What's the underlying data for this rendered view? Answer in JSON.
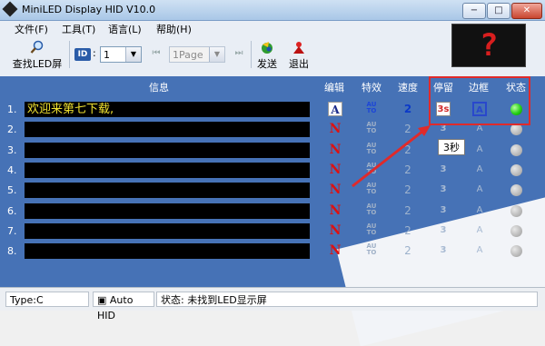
{
  "window": {
    "title": "MiniLED Display HID V10.0",
    "min_label": "−",
    "max_label": "□",
    "close_label": "✕"
  },
  "menu": [
    {
      "label": "文件(F)"
    },
    {
      "label": "工具(T)"
    },
    {
      "label": "语言(L)"
    },
    {
      "label": "帮助(H)"
    }
  ],
  "toolbar": {
    "search_label": "查找LED屏",
    "id_label": "ID",
    "id_value": "1",
    "page_value": "1Page",
    "send_label": "发送",
    "exit_label": "退出"
  },
  "led_preview": {
    "glyph": "?"
  },
  "table": {
    "headers": {
      "info": "信息",
      "edit": "编辑",
      "effect": "特效",
      "speed": "速度",
      "stay": "停留",
      "border": "边框",
      "status": "状态"
    },
    "rows": [
      {
        "num": "1.",
        "message": "欢迎来第七下载,",
        "edit": "A",
        "effect_top": "AU",
        "effect_bottom": "TO",
        "speed": "2",
        "stay": "3s",
        "border": "A",
        "active": true
      },
      {
        "num": "2.",
        "message": "",
        "edit": "N",
        "effect_top": "AU",
        "effect_bottom": "TO",
        "speed": "2",
        "stay": "3",
        "border": "A",
        "active": false
      },
      {
        "num": "3.",
        "message": "",
        "edit": "N",
        "effect_top": "AU",
        "effect_bottom": "TO",
        "speed": "2",
        "stay": "3",
        "border": "A",
        "active": false
      },
      {
        "num": "4.",
        "message": "",
        "edit": "N",
        "effect_top": "AU",
        "effect_bottom": "TO",
        "speed": "2",
        "stay": "3",
        "border": "A",
        "active": false
      },
      {
        "num": "5.",
        "message": "",
        "edit": "N",
        "effect_top": "AU",
        "effect_bottom": "TO",
        "speed": "2",
        "stay": "3",
        "border": "A",
        "active": false
      },
      {
        "num": "6.",
        "message": "",
        "edit": "N",
        "effect_top": "AU",
        "effect_bottom": "TO",
        "speed": "2",
        "stay": "3",
        "border": "A",
        "active": false
      },
      {
        "num": "7.",
        "message": "",
        "edit": "N",
        "effect_top": "AU",
        "effect_bottom": "TO",
        "speed": "2",
        "stay": "3",
        "border": "A",
        "active": false
      },
      {
        "num": "8.",
        "message": "",
        "edit": "N",
        "effect_top": "AU",
        "effect_bottom": "TO",
        "speed": "2",
        "stay": "3",
        "border": "A",
        "active": false
      }
    ]
  },
  "tooltip": {
    "text": "3秒"
  },
  "colors": {
    "panel": "#4672b6",
    "led_text": "#f0e130",
    "highlight": "#e02a2a",
    "status_on": "#25d016"
  },
  "statusbar": {
    "type": "Type:C",
    "mode": "Auto HID",
    "status": "状态: 未找到LED显示屏"
  }
}
